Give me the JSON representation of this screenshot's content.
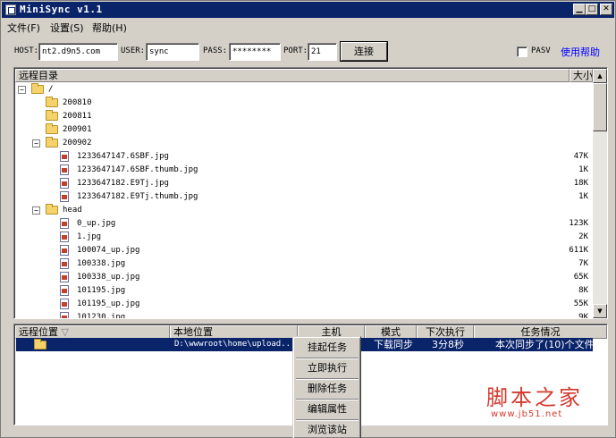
{
  "window": {
    "title": "MiniSync v1.1"
  },
  "menu": [
    {
      "label": "文件(F)"
    },
    {
      "label": "设置(S)"
    },
    {
      "label": "帮助(H)"
    }
  ],
  "connection": {
    "host_label": "HOST:",
    "host_value": "nt2.d9n5.com",
    "user_label": "USER:",
    "user_value": "sync",
    "pass_label": "PASS:",
    "pass_value": "********",
    "port_label": "PORT:",
    "port_value": "21",
    "connect_label": "连接",
    "pasv_label": "PASV",
    "help_label": "使用帮助"
  },
  "remote": {
    "header_dir": "远程目录",
    "header_size": "大小",
    "tree": [
      {
        "label": "/",
        "type": "folder",
        "expander": "⊟",
        "size": ""
      },
      {
        "label": "200810",
        "type": "folder",
        "expander": "",
        "size": ""
      },
      {
        "label": "200811",
        "type": "folder",
        "expander": "",
        "size": ""
      },
      {
        "label": "200901",
        "type": "folder",
        "expander": "",
        "size": ""
      },
      {
        "label": "200902",
        "type": "folder",
        "expander": "⊟",
        "size": ""
      },
      {
        "label": "1233647147.6SBF.jpg",
        "type": "file",
        "expander": "",
        "size": "47K"
      },
      {
        "label": "1233647147.6SBF.thumb.jpg",
        "type": "file",
        "expander": "",
        "size": "1K"
      },
      {
        "label": "1233647182.E9Tj.jpg",
        "type": "file",
        "expander": "",
        "size": "18K"
      },
      {
        "label": "1233647182.E9Tj.thumb.jpg",
        "type": "file",
        "expander": "",
        "size": "1K"
      },
      {
        "label": "head",
        "type": "folder",
        "expander": "⊟",
        "size": ""
      },
      {
        "label": "0_up.jpg",
        "type": "file",
        "expander": "",
        "size": "123K"
      },
      {
        "label": "1.jpg",
        "type": "file",
        "expander": "",
        "size": "2K"
      },
      {
        "label": "100074_up.jpg",
        "type": "file",
        "expander": "",
        "size": "611K"
      },
      {
        "label": "100338.jpg",
        "type": "file",
        "expander": "",
        "size": "7K"
      },
      {
        "label": "100338_up.jpg",
        "type": "file",
        "expander": "",
        "size": "65K"
      },
      {
        "label": "101195.jpg",
        "type": "file",
        "expander": "",
        "size": "8K"
      },
      {
        "label": "101195_up.jpg",
        "type": "file",
        "expander": "",
        "size": "55K"
      },
      {
        "label": "101230.jpg",
        "type": "file",
        "expander": "",
        "size": "9K"
      }
    ]
  },
  "tasks": {
    "headers": {
      "remote": "远程位置",
      "local": "本地位置",
      "host": "主机",
      "mode": "模式",
      "next": "下次执行",
      "status": "任务情况"
    },
    "rows": [
      {
        "remote": "",
        "local": "D:\\wwwroot\\home\\upload...",
        "host": "",
        "mode": "下载同步",
        "next": "3分8秒",
        "status": "本次同步了(10)个文件"
      }
    ]
  },
  "context_menu": [
    {
      "label": "挂起任务"
    },
    {
      "label": "立即执行"
    },
    {
      "label": "删除任务"
    },
    {
      "label": "编辑属性"
    },
    {
      "label": "浏览该站"
    }
  ],
  "watermark": {
    "text": "脚本之家",
    "url": "www.jb51.net"
  }
}
